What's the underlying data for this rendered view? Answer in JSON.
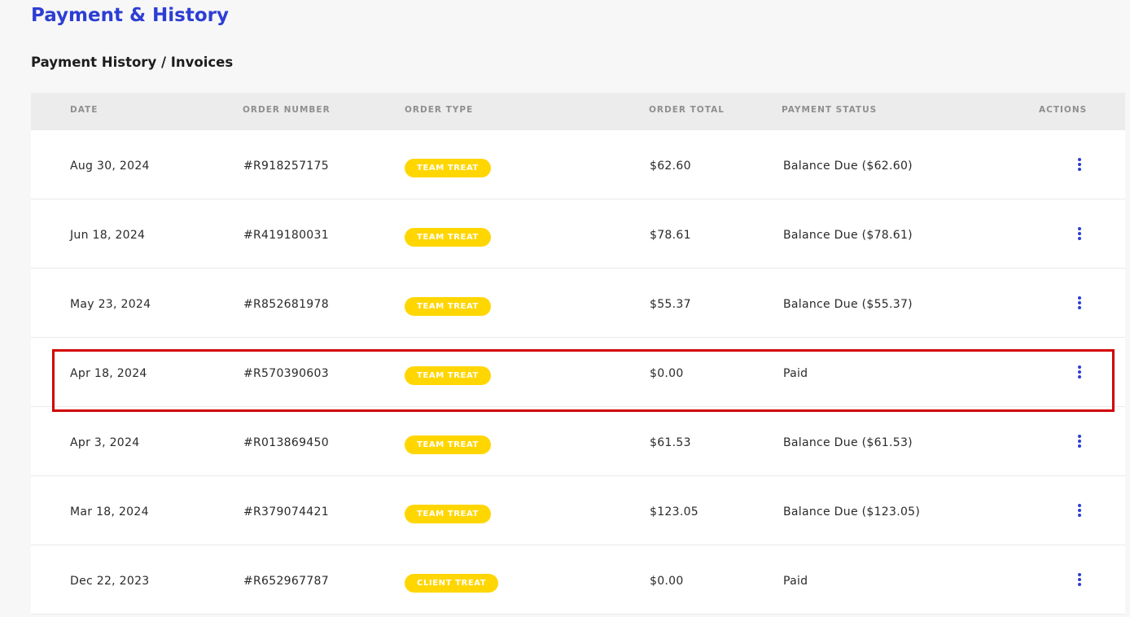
{
  "header": {
    "title": "Payment & History",
    "subtitle": "Payment History / Invoices"
  },
  "table": {
    "columns": [
      "DATE",
      "ORDER NUMBER",
      "ORDER TYPE",
      "ORDER TOTAL",
      "PAYMENT STATUS",
      "ACTIONS"
    ],
    "rows": [
      {
        "date": "Aug 30, 2024",
        "order_number": "#R918257175",
        "order_type": "TEAM TREAT",
        "total": "$62.60",
        "status": "Balance Due ($62.60)",
        "actions_icon": "more-vertical-icon"
      },
      {
        "date": "Jun 18, 2024",
        "order_number": "#R419180031",
        "order_type": "TEAM TREAT",
        "total": "$78.61",
        "status": "Balance Due ($78.61)",
        "actions_icon": "more-vertical-icon"
      },
      {
        "date": "May 23, 2024",
        "order_number": "#R852681978",
        "order_type": "TEAM TREAT",
        "total": "$55.37",
        "status": "Balance Due ($55.37)",
        "actions_icon": "more-vertical-icon"
      },
      {
        "date": "Apr 18, 2024",
        "order_number": "#R570390603",
        "order_type": "TEAM TREAT",
        "total": "$0.00",
        "status": "Paid",
        "actions_icon": "more-vertical-icon"
      },
      {
        "date": "Apr 3, 2024",
        "order_number": "#R013869450",
        "order_type": "TEAM TREAT",
        "total": "$61.53",
        "status": "Balance Due ($61.53)",
        "actions_icon": "more-vertical-icon"
      },
      {
        "date": "Mar 18, 2024",
        "order_number": "#R379074421",
        "order_type": "TEAM TREAT",
        "total": "$123.05",
        "status": "Balance Due ($123.05)",
        "actions_icon": "more-vertical-icon"
      },
      {
        "date": "Dec 22, 2023",
        "order_number": "#R652967787",
        "order_type": "CLIENT TREAT",
        "total": "$0.00",
        "status": "Paid",
        "actions_icon": "more-vertical-icon"
      }
    ]
  },
  "highlighted_row": 3,
  "colors": {
    "accent": "#2d3ed3",
    "badge": "#ffd600",
    "highlight": "#d10000"
  }
}
